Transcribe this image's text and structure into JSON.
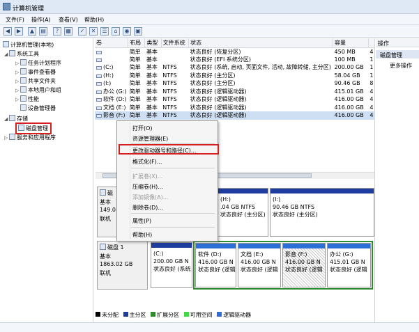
{
  "window": {
    "title": "计算机管理"
  },
  "menu": [
    "文件(F)",
    "操作(A)",
    "查看(V)",
    "帮助(H)"
  ],
  "tree": {
    "root": "计算机管理(本地)",
    "system_tools": "系统工具",
    "task_scheduler": "任务计划程序",
    "event_viewer": "事件查看器",
    "shared_folders": "共享文件夹",
    "local_users": "本地用户和组",
    "performance": "性能",
    "device_manager": "设备管理器",
    "storage": "存储",
    "disk_management": "磁盘管理",
    "services": "服务和应用程序"
  },
  "volumes": {
    "headers": [
      "卷",
      "布局",
      "类型",
      "文件系统",
      "状态",
      "容量",
      ""
    ],
    "rows": [
      [
        "",
        "简单",
        "基本",
        "",
        "状态良好 (恢复分区)",
        "450 MB",
        "4"
      ],
      [
        "",
        "简单",
        "基本",
        "",
        "状态良好 (EFI 系统分区)",
        "100 MB",
        "1"
      ],
      [
        "(C:)",
        "简单",
        "基本",
        "NTFS",
        "状态良好 (系统, 启动, 页面文件, 活动, 故障转储, 主分区)",
        "200.00 GB",
        "1"
      ],
      [
        "(H:)",
        "简单",
        "基本",
        "NTFS",
        "状态良好 (主分区)",
        "58.04 GB",
        "1"
      ],
      [
        "(I:)",
        "简单",
        "基本",
        "NTFS",
        "状态良好 (主分区)",
        "90.46 GB",
        "8"
      ],
      [
        "办公 (G:)",
        "简单",
        "基本",
        "NTFS",
        "状态良好 (逻辑驱动器)",
        "415.01 GB",
        "4"
      ],
      [
        "软件 (D:)",
        "简单",
        "基本",
        "NTFS",
        "状态良好 (逻辑驱动器)",
        "416.00 GB",
        "4"
      ],
      [
        "文档 (E:)",
        "简单",
        "基本",
        "NTFS",
        "状态良好 (逻辑驱动器)",
        "416.00 GB",
        "4"
      ],
      [
        "影音 (F:)",
        "简单",
        "基本",
        "NTFS",
        "状态良好 (逻辑驱动器)",
        "416.00 GB",
        "4"
      ]
    ]
  },
  "actions": {
    "header": "操作",
    "selected": "磁盘管理",
    "more": "更多操作"
  },
  "context_menu": {
    "open": "打开(O)",
    "explore": "资源管理器(E)",
    "change_letter": "更改驱动器号和路径(C)...",
    "format": "格式化(F)...",
    "extend": "扩展卷(X)...",
    "shrink": "压缩卷(H)...",
    "mirror": "添加镜像(A)...",
    "delete": "删除卷(D)...",
    "properties": "属性(P)",
    "help": "帮助(H)"
  },
  "disk0": {
    "name": "磁",
    "type": "基本",
    "size": "149.0",
    "status": "联机",
    "parts": [
      {
        "label": "(H:)",
        "size": ".04 GB NTFS",
        "status": "状态良好 (主分区)"
      },
      {
        "label": "(I:)",
        "size": "90.46 GB NTFS",
        "status": "状态良好 (主分区)"
      }
    ]
  },
  "disk1": {
    "name": "磁盘 1",
    "type": "基本",
    "size": "1863.02 GB",
    "status": "联机",
    "parts": [
      {
        "label": "(C:)",
        "size": "200.00 GB N",
        "status": "状态良好 (系统"
      },
      {
        "label": "软件 (D:)",
        "size": "416.00 GB N",
        "status": "状态良好 (逻辑"
      },
      {
        "label": "文档 (E:)",
        "size": "416.00 GB N",
        "status": "状态良好 (逻辑"
      },
      {
        "label": "影音 (F:)",
        "size": "416.00 GB N",
        "status": "状态良好 (逻辑"
      },
      {
        "label": "办公 (G:)",
        "size": "415.01 GB N",
        "status": "状态良好 (逻辑"
      }
    ]
  },
  "legend": [
    "未分配",
    "主分区",
    "扩展分区",
    "可用空间",
    "逻辑驱动器"
  ],
  "colors": {
    "unallocated": "#000000",
    "primary": "#1f3d9e",
    "extended": "#2e8b2e",
    "free": "#44d744",
    "logical": "#2d6fd6",
    "highlight_red": "#d42020"
  }
}
